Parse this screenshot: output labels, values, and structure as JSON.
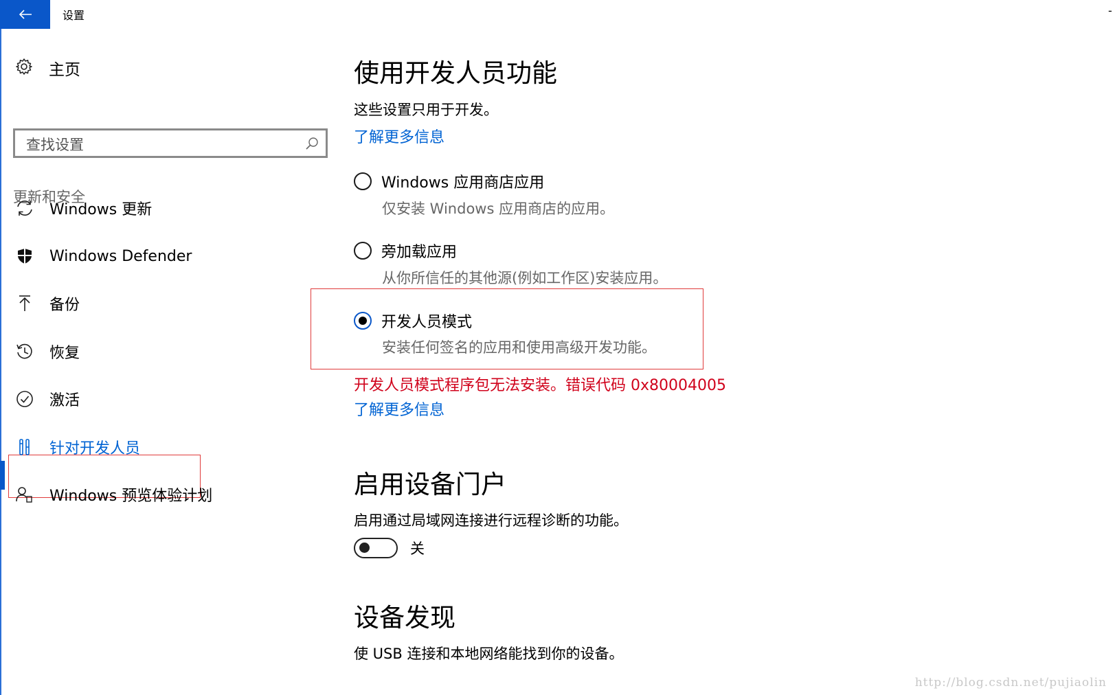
{
  "titlebar": {
    "title": "设置",
    "back_icon": "arrow-left-icon",
    "control_glyph": "-"
  },
  "sidebar": {
    "home": {
      "label": "主页",
      "icon": "gear-icon"
    },
    "search": {
      "placeholder": "查找设置",
      "value": "",
      "icon": "search-icon"
    },
    "section_label": "更新和安全",
    "items": [
      {
        "label": "Windows 更新",
        "icon": "sync-icon",
        "active": false
      },
      {
        "label": "Windows Defender",
        "icon": "shield-icon",
        "active": false
      },
      {
        "label": "备份",
        "icon": "upload-arrow-icon",
        "active": false
      },
      {
        "label": "恢复",
        "icon": "history-icon",
        "active": false
      },
      {
        "label": "激活",
        "icon": "check-circle-icon",
        "active": false
      },
      {
        "label": "针对开发人员",
        "icon": "developer-tools-icon",
        "active": true
      },
      {
        "label": "Windows 预览体验计划",
        "icon": "insider-person-icon",
        "active": false
      }
    ],
    "accent_color": "#0063d3",
    "highlight_color": "#e03a3a"
  },
  "main": {
    "dev_section": {
      "title": "使用开发人员功能",
      "description": "这些设置只用于开发。",
      "learn_more": "了解更多信息",
      "options": [
        {
          "label": "Windows 应用商店应用",
          "description": "仅安装 Windows 应用商店的应用。",
          "selected": false
        },
        {
          "label": "旁加载应用",
          "description": "从你所信任的其他源(例如工作区)安装应用。",
          "selected": false
        },
        {
          "label": "开发人员模式",
          "description": "安装任何签名的应用和使用高级开发功能。",
          "selected": true
        }
      ],
      "error": "开发人员模式程序包无法安装。错误代码 0x80004005",
      "error_color": "#d0021b",
      "error_learn_more": "了解更多信息"
    },
    "portal_section": {
      "title": "启用设备门户",
      "description": "启用通过局域网连接进行远程诊断的功能。",
      "toggle_state": "关",
      "toggle_on": false
    },
    "discovery_section": {
      "title": "设备发现",
      "description": "使 USB 连接和本地网络能找到你的设备。"
    }
  },
  "watermark": "http://blog.csdn.net/pujiaolin"
}
